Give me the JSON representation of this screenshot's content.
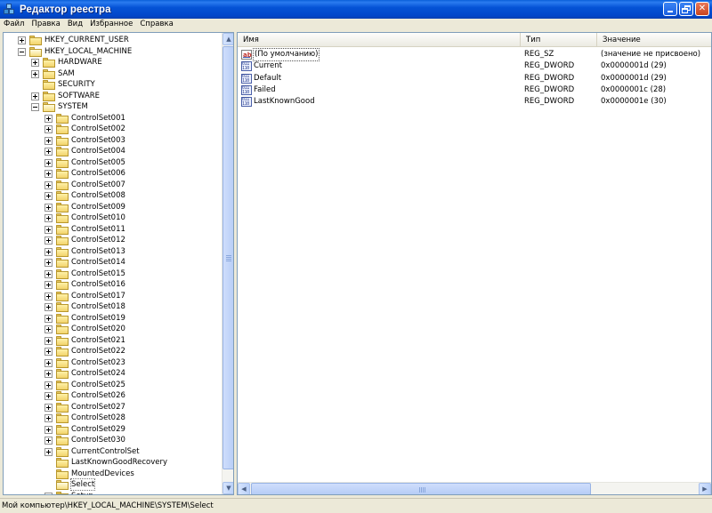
{
  "window": {
    "title": "Редактор реестра"
  },
  "menu": [
    "Файл",
    "Правка",
    "Вид",
    "Избранное",
    "Справка"
  ],
  "tree": {
    "hkcu": "HKEY_CURRENT_USER",
    "hklm": "HKEY_LOCAL_MACHINE",
    "hklm_children": [
      "HARDWARE",
      "SAM",
      "SECURITY",
      "SOFTWARE",
      "SYSTEM"
    ],
    "control_sets": [
      "ControlSet001",
      "ControlSet002",
      "ControlSet003",
      "ControlSet004",
      "ControlSet005",
      "ControlSet006",
      "ControlSet007",
      "ControlSet008",
      "ControlSet009",
      "ControlSet010",
      "ControlSet011",
      "ControlSet012",
      "ControlSet013",
      "ControlSet014",
      "ControlSet015",
      "ControlSet016",
      "ControlSet017",
      "ControlSet018",
      "ControlSet019",
      "ControlSet020",
      "ControlSet021",
      "ControlSet022",
      "ControlSet023",
      "ControlSet024",
      "ControlSet025",
      "ControlSet026",
      "ControlSet027",
      "ControlSet028",
      "ControlSet029",
      "ControlSet030"
    ],
    "system_tail": [
      "CurrentControlSet",
      "LastKnownGoodRecovery",
      "MountedDevices",
      "Select",
      "Setup"
    ]
  },
  "list": {
    "columns": {
      "name": "Имя",
      "type": "Тип",
      "value": "Значение"
    },
    "rows": [
      {
        "name": "(По умолчанию)",
        "type": "REG_SZ",
        "value": "(значение не присвоено)",
        "icon": "string-value-icon"
      },
      {
        "name": "Current",
        "type": "REG_DWORD",
        "value": "0x0000001d (29)",
        "icon": "dword-value-icon"
      },
      {
        "name": "Default",
        "type": "REG_DWORD",
        "value": "0x0000001d (29)",
        "icon": "dword-value-icon"
      },
      {
        "name": "Failed",
        "type": "REG_DWORD",
        "value": "0x0000001c (28)",
        "icon": "dword-value-icon"
      },
      {
        "name": "LastKnownGood",
        "type": "REG_DWORD",
        "value": "0x0000001e (30)",
        "icon": "dword-value-icon"
      }
    ]
  },
  "status": {
    "path": "Мой компьютер\\HKEY_LOCAL_MACHINE\\SYSTEM\\Select"
  },
  "colors": {
    "titlebar": "#0553d6",
    "selection": "#316ac5"
  }
}
